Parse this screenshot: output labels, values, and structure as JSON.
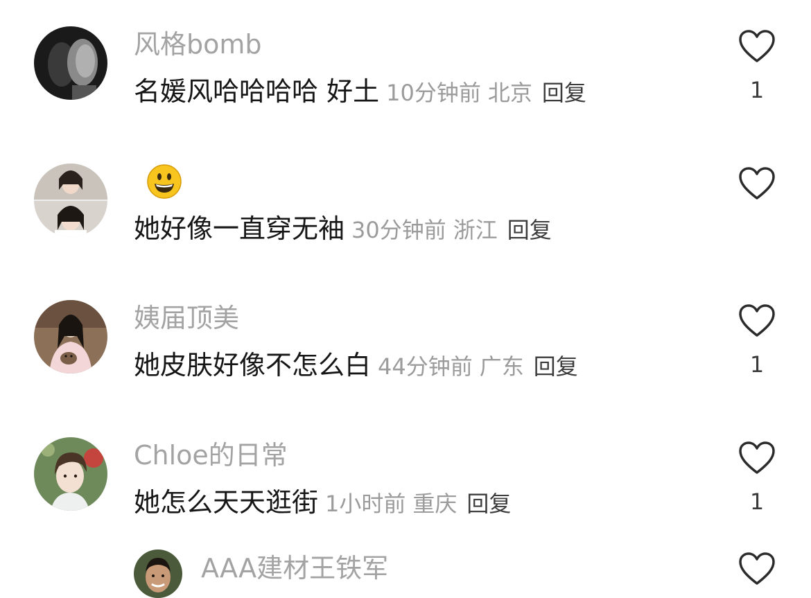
{
  "comments": [
    {
      "username": "风格bomb",
      "text": "名媛风哈哈哈哈 好土",
      "time": "10分钟前",
      "location": "北京",
      "reply_label": "回复",
      "likes": "1",
      "avatar_icon": "avatar-sculpture-faces"
    },
    {
      "username": "",
      "username_icon": "grinning-face-emoji",
      "text": "她好像一直穿无袖",
      "time": "30分钟前",
      "location": "浙江",
      "reply_label": "回复",
      "likes": "",
      "avatar_icon": "avatar-woman-collage"
    },
    {
      "username": "姨届顶美",
      "text": "她皮肤好像不怎么白",
      "time": "44分钟前",
      "location": "广东",
      "reply_label": "回复",
      "likes": "1",
      "avatar_icon": "avatar-woman-with-cat"
    },
    {
      "username": "Chloe的日常",
      "text": "她怎么天天逛街",
      "time": "1小时前",
      "location": "重庆",
      "reply_label": "回复",
      "likes": "1",
      "avatar_icon": "avatar-child"
    },
    {
      "username": "AAA建材王铁军",
      "likes": "",
      "avatar_icon": "avatar-smiling-man"
    }
  ],
  "colors": {
    "username": "#a3a3a3",
    "content": "#161616",
    "meta": "#9b9b9b",
    "heart_stroke": "#2b2b2b"
  }
}
